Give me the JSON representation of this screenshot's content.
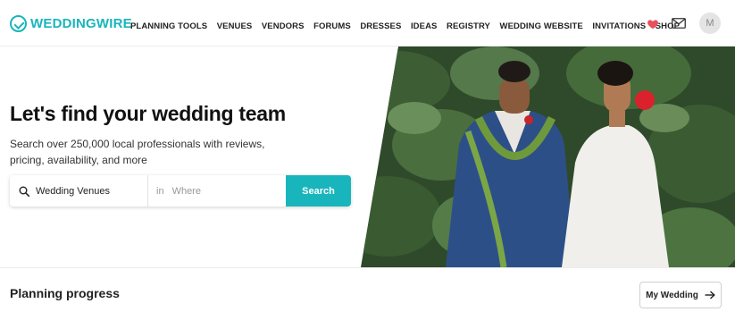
{
  "header": {
    "logo_text": "WEDDINGWIRE",
    "nav": [
      {
        "label": "PLANNING TOOLS"
      },
      {
        "label": "VENUES"
      },
      {
        "label": "VENDORS"
      },
      {
        "label": "FORUMS"
      },
      {
        "label": "DRESSES"
      },
      {
        "label": "IDEAS"
      },
      {
        "label": "REGISTRY"
      },
      {
        "label": "WEDDING WEBSITE"
      },
      {
        "label": "INVITATIONS"
      },
      {
        "label": "SHOP"
      }
    ],
    "heart_icon": "heart-icon",
    "mail_icon": "mail-icon",
    "avatar_initial": "M"
  },
  "hero": {
    "title": "Let's find your wedding team",
    "subtitle": "Search over 250,000 local professionals with reviews, pricing, availability, and more"
  },
  "search": {
    "category_value": "Wedding Venues",
    "in_label": "in",
    "location_placeholder": "Where",
    "button_label": "Search"
  },
  "planning": {
    "title": "Planning progress",
    "button_label": "My Wedding"
  },
  "colors": {
    "brand": "#19b5bc",
    "heart": "#e8505b"
  }
}
